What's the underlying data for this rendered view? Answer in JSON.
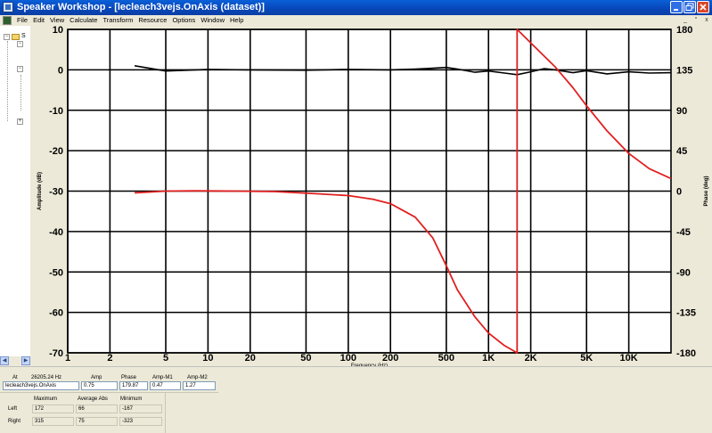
{
  "window": {
    "title": "Speaker Workshop - [lecleach3vejs.OnAxis (dataset)]",
    "controls": [
      "minimize-icon",
      "restore-icon",
      "close-icon"
    ]
  },
  "menu": {
    "items": [
      "File",
      "Edit",
      "View",
      "Calculate",
      "Transform",
      "Resource",
      "Options",
      "Window",
      "Help"
    ],
    "mdi_controls": [
      "_",
      "°",
      "x"
    ]
  },
  "tree": {
    "root_label": "S"
  },
  "chart_data": {
    "type": "line",
    "xlabel": "Frequency (Hz)",
    "ylabel_left": "Amplitude (dB)",
    "ylabel_right": "Phase (deg)",
    "x_scale": "log",
    "xlim": [
      1,
      20000
    ],
    "x_ticks": [
      1,
      2,
      5,
      10,
      20,
      50,
      100,
      200,
      500,
      1000,
      2000,
      5000,
      10000
    ],
    "x_tick_labels": [
      "1",
      "2",
      "5",
      "10",
      "20",
      "50",
      "100",
      "200",
      "500",
      "1K",
      "2K",
      "5K",
      "10K"
    ],
    "y_left_lim": [
      -70,
      10
    ],
    "y_left_ticks": [
      10,
      0,
      -10,
      -20,
      -30,
      -40,
      -50,
      -60,
      -70
    ],
    "y_right_lim": [
      -180,
      180
    ],
    "y_right_ticks": [
      180,
      135,
      90,
      45,
      0,
      -45,
      -90,
      -135,
      -180
    ],
    "grid": true,
    "series": [
      {
        "axis": "left",
        "color": "#000000",
        "points": [
          [
            3,
            1
          ],
          [
            5,
            -0.3
          ],
          [
            10,
            0.1
          ],
          [
            20,
            0
          ],
          [
            50,
            -0.1
          ],
          [
            100,
            0.1
          ],
          [
            200,
            0
          ],
          [
            300,
            0.2
          ],
          [
            400,
            0.4
          ],
          [
            500,
            0.6
          ],
          [
            600,
            0.2
          ],
          [
            800,
            -0.6
          ],
          [
            1000,
            -0.3
          ],
          [
            1300,
            -0.8
          ],
          [
            1600,
            -1.2
          ],
          [
            2000,
            -0.5
          ],
          [
            2500,
            0.3
          ],
          [
            3000,
            0
          ],
          [
            4000,
            -0.7
          ],
          [
            5000,
            -0.2
          ],
          [
            7000,
            -1
          ],
          [
            10000,
            -0.5
          ],
          [
            14000,
            -0.8
          ],
          [
            20000,
            -0.7
          ]
        ]
      },
      {
        "axis": "right",
        "color": "#e02020",
        "points": [
          [
            3,
            -2
          ],
          [
            5,
            0
          ],
          [
            8,
            0.3
          ],
          [
            15,
            0
          ],
          [
            30,
            -0.5
          ],
          [
            60,
            -3
          ],
          [
            100,
            -5
          ],
          [
            150,
            -9
          ],
          [
            200,
            -14
          ],
          [
            300,
            -29
          ],
          [
            400,
            -52
          ],
          [
            500,
            -83
          ],
          [
            600,
            -110
          ],
          [
            800,
            -140
          ],
          [
            1000,
            -158
          ],
          [
            1300,
            -172
          ],
          [
            1600,
            -180
          ],
          [
            1600,
            180
          ],
          [
            2000,
            165
          ],
          [
            3000,
            138
          ],
          [
            4000,
            115
          ],
          [
            5000,
            95
          ],
          [
            7000,
            67
          ],
          [
            10000,
            42
          ],
          [
            14000,
            25
          ],
          [
            20000,
            14
          ]
        ]
      }
    ]
  },
  "readout": {
    "at_label": "At",
    "at_value": "26205.24 Hz",
    "columns": [
      "Amp",
      "Phase",
      "Amp-M1",
      "Amp-M2"
    ],
    "dataset": "lecleach3vejs.OnAxis",
    "values": [
      "0.75",
      "179.87",
      "0.47",
      "1.27"
    ]
  },
  "stats": {
    "columns": [
      "Maximum",
      "Average Abs",
      "Minimum"
    ],
    "rows": [
      {
        "label": "Left",
        "values": [
          "172",
          "66",
          "-167"
        ]
      },
      {
        "label": "Right",
        "values": [
          "315",
          "75",
          "-323"
        ]
      }
    ]
  }
}
